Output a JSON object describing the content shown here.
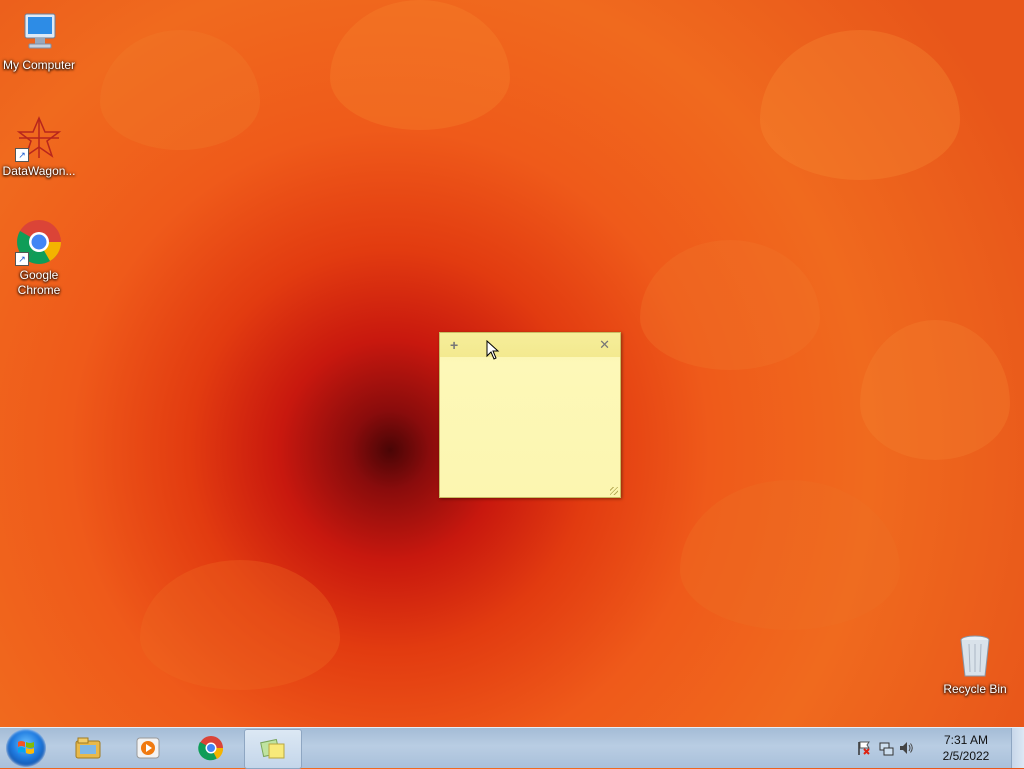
{
  "desktop": {
    "icons": [
      {
        "label": "My Computer",
        "icon": "computer-icon"
      },
      {
        "label": "DataWagon...",
        "icon": "datawagon-icon"
      },
      {
        "label": "Google Chrome",
        "icon": "chrome-icon"
      },
      {
        "label": "Recycle Bin",
        "icon": "recycle-bin-icon"
      }
    ]
  },
  "sticky_note": {
    "add_glyph": "+",
    "close_glyph": "✕",
    "text": "",
    "color": "#fdf8b8"
  },
  "taskbar": {
    "pinned": [
      {
        "name": "windows-explorer",
        "icon": "folder-icon"
      },
      {
        "name": "media-player",
        "icon": "media-player-icon"
      },
      {
        "name": "google-chrome",
        "icon": "chrome-icon"
      },
      {
        "name": "sticky-notes",
        "icon": "sticky-notes-icon",
        "active": true
      }
    ],
    "tray": {
      "icons": [
        "action-center-flag-icon",
        "network-icon",
        "volume-icon"
      ],
      "time": "7:31 AM",
      "date": "2/5/2022"
    }
  }
}
